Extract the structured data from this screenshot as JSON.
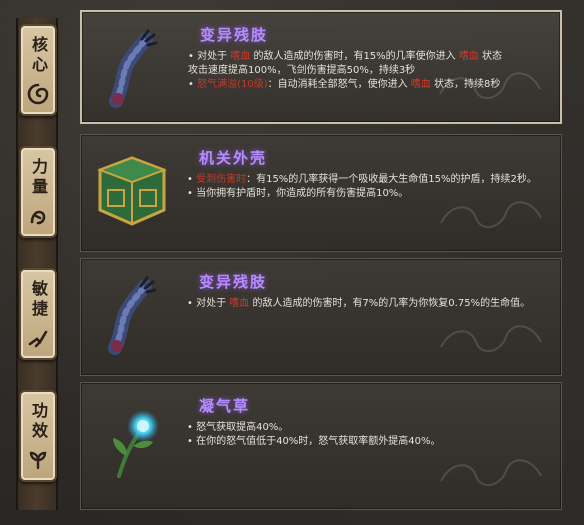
{
  "tabs": [
    {
      "label": "核心",
      "icon": "spiral-emblem-icon"
    },
    {
      "label": "力量",
      "icon": "fist-emblem-icon"
    },
    {
      "label": "敏捷",
      "icon": "dash-emblem-icon"
    },
    {
      "label": "功效",
      "icon": "leaf-emblem-icon"
    }
  ],
  "items": [
    {
      "title": "变异残肢",
      "icon": "mutated-limb-icon",
      "lines": [
        {
          "pre": "• 对处于 ",
          "hl": "嗜血",
          "post": " 的敌人造成的伤害时，有15%的几率使你进入 ",
          "hl2": "嗜血",
          "post2": " 状态"
        },
        {
          "pre": "  攻击速度提高100%，飞剑伤害提高50%，持续3秒",
          "hl": "",
          "post": "",
          "hl2": "",
          "post2": ""
        },
        {
          "pre": "• ",
          "hl": "怒气满溢(10级)",
          "post": "：自动消耗全部怒气，使你进入 ",
          "hl2": "嗜血",
          "post2": " 状态，持续8秒"
        }
      ]
    },
    {
      "title": "机关外壳",
      "icon": "mechanism-box-icon",
      "lines": [
        {
          "pre": "• ",
          "hl": "受到伤害时",
          "post": "：有15%的几率获得一个吸收最大生命值15%的护盾，持续2秒。",
          "hl2": "",
          "post2": ""
        },
        {
          "pre": "• 当你拥有护盾时，你造成的所有伤害提高10%。",
          "hl": "",
          "post": "",
          "hl2": "",
          "post2": ""
        }
      ]
    },
    {
      "title": "变异残肢",
      "icon": "mutated-limb-icon",
      "lines": [
        {
          "pre": "• 对处于 ",
          "hl": "嗜血",
          "post": " 的敌人造成的伤害时，有7%的几率为你恢复0.75%的生命值。",
          "hl2": "",
          "post2": ""
        }
      ]
    },
    {
      "title": "凝气草",
      "icon": "glowing-herb-icon",
      "lines": [
        {
          "pre": "• 怒气获取提高40%。",
          "hl": "",
          "post": "",
          "hl2": "",
          "post2": ""
        },
        {
          "pre": "• 在你的怒气值低于40%时，怒气获取率额外提高40%。",
          "hl": "",
          "post": "",
          "hl2": "",
          "post2": ""
        }
      ]
    }
  ]
}
